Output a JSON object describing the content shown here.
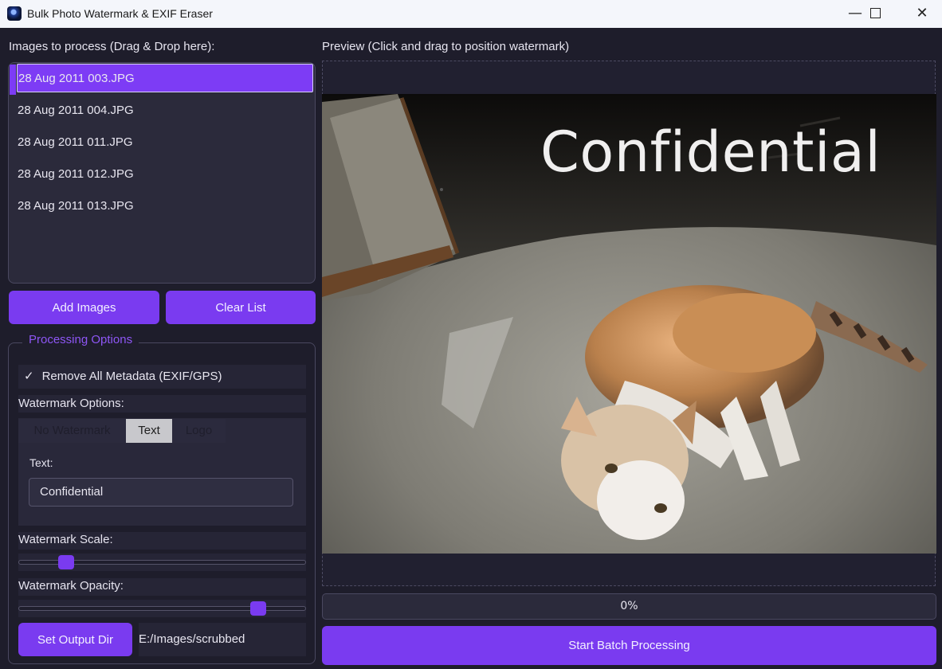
{
  "window": {
    "title": "Bulk Photo Watermark & EXIF Eraser",
    "controls": {
      "minimize": "—",
      "maximize": "☐",
      "close": "✕"
    }
  },
  "left": {
    "images_label": "Images to process (Drag & Drop here):",
    "files": [
      "28 Aug 2011 003.JPG",
      "28 Aug 2011 004.JPG",
      "28 Aug 2011 011.JPG",
      "28 Aug 2011 012.JPG",
      "28 Aug 2011 013.JPG"
    ],
    "selected_index": 0,
    "add_images_label": "Add Images",
    "clear_list_label": "Clear List"
  },
  "options": {
    "group_title": "Processing Options",
    "remove_metadata_label": "Remove All Metadata (EXIF/GPS)",
    "remove_metadata_checked": true,
    "watermark_options_label": "Watermark Options:",
    "tabs": [
      "No Watermark",
      "Text",
      "Logo"
    ],
    "active_tab": "Text",
    "text_label": "Text:",
    "text_value": "Confidential",
    "scale_label": "Watermark Scale:",
    "scale_value": 0.12,
    "opacity_label": "Watermark Opacity:",
    "opacity_value": 0.88,
    "set_output_label": "Set Output Dir",
    "output_path": "E:/Images/scrubbed"
  },
  "preview": {
    "label": "Preview (Click and drag to position watermark)",
    "watermark_text": "Confidential"
  },
  "progress": {
    "text": "0%",
    "value": 0
  },
  "start_label": "Start Batch Processing",
  "colors": {
    "accent": "#7a3bf0",
    "background": "#1e1d2b",
    "panel": "#2b2a3b",
    "group_title": "#8e56f5"
  }
}
